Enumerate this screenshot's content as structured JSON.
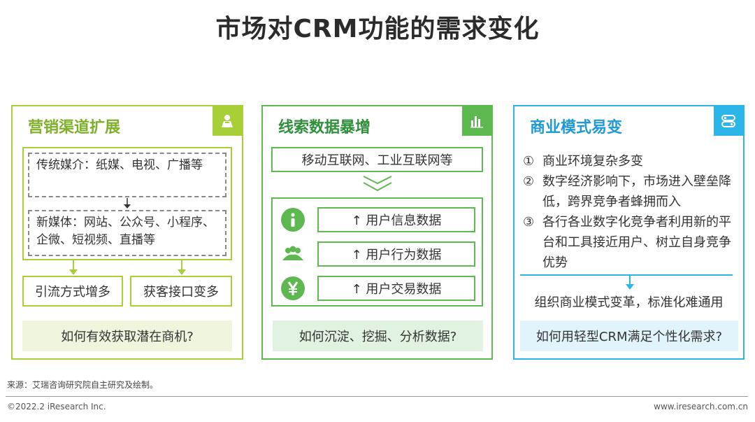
{
  "title": "市场对CRM功能的需求变化",
  "colors": {
    "panel1": "#a6cf38",
    "panel2": "#5db84f",
    "panel3": "#2cb5e8"
  },
  "panel1": {
    "title": "营销渠道扩展",
    "badge_icon": "person-icon",
    "traditional": "传统媒介：纸媒、电视、广播等",
    "new_media": "新媒体：网站、公众号、小程序、企微、短视频、直播等",
    "outcome_left": "引流方式增多",
    "outcome_right": "获客接口变多",
    "question": "如何有效获取潜在商机?"
  },
  "panel2": {
    "title": "线索数据暴增",
    "badge_icon": "bar-chart-icon",
    "source": "移动互联网、工业互联网等",
    "rows": [
      {
        "icon": "info-icon",
        "label": "↑  用户信息数据"
      },
      {
        "icon": "people-icon",
        "label": "↑  用户行为数据"
      },
      {
        "icon": "yen-icon",
        "label": "↑  用户交易数据"
      }
    ],
    "question": "如何沉淀、挖掘、分析数据?"
  },
  "panel3": {
    "title": "商业模式易变",
    "badge_icon": "server-toggle-icon",
    "bullets": [
      {
        "n": "①",
        "text": "商业环境复杂多变"
      },
      {
        "n": "②",
        "text": "数字经济影响下，市场进入壁垒降低，跨界竞争者蜂拥而入"
      },
      {
        "n": "③",
        "text": "各行各业数字化竞争者利用新的平台和工具接近用户、树立自身竞争优势"
      }
    ],
    "result": "组织商业模式变革，标准化难通用",
    "question": "如何用轻型CRM满足个性化需求?"
  },
  "footer": {
    "source": "来源：艾瑞咨询研究院自主研究及绘制。",
    "copyright": "©2022.2 iResearch Inc.",
    "url": "www.iresearch.com.cn"
  }
}
